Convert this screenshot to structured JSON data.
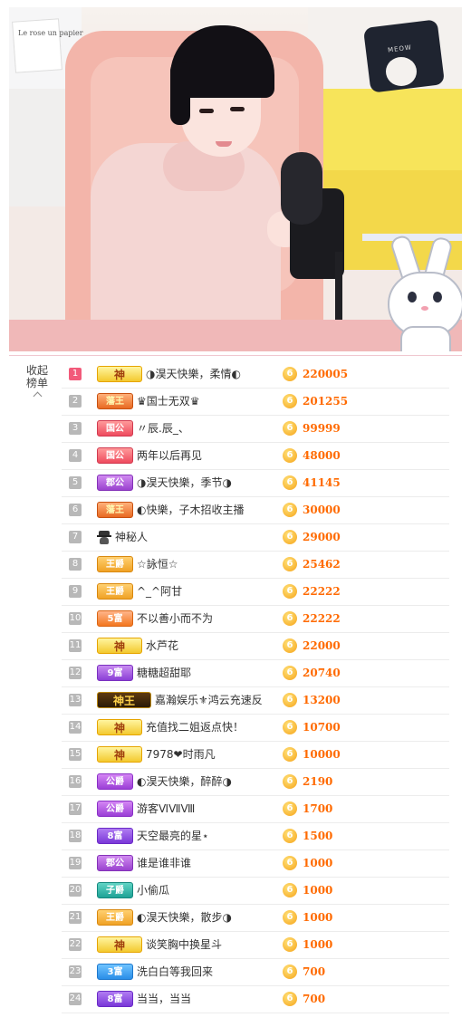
{
  "stream": {
    "poster_text": "Le rose un papier",
    "pillow_text": "MEOW"
  },
  "sidebar": {
    "collapse_label": "收起",
    "title": "榜单"
  },
  "ranking": [
    {
      "rank": "1",
      "badge": "神",
      "badge_type": "shen",
      "name": "◑淏天快樂，柔情◐",
      "amount": "220005"
    },
    {
      "rank": "2",
      "badge": "藩王",
      "badge_type": "wang",
      "name": "♛国士无双♛",
      "amount": "201255"
    },
    {
      "rank": "3",
      "badge": "国公",
      "badge_type": "guo",
      "name": "〃辰.辰_、",
      "amount": "99999"
    },
    {
      "rank": "4",
      "badge": "国公",
      "badge_type": "guo",
      "name": "两年以后再见",
      "amount": "48000"
    },
    {
      "rank": "5",
      "badge": "郡公",
      "badge_type": "du",
      "name": "◑淏天快樂，季节◑",
      "amount": "41145"
    },
    {
      "rank": "6",
      "badge": "藩王",
      "badge_type": "wang",
      "name": "◐快樂，子木招收主播",
      "amount": "30000"
    },
    {
      "rank": "7",
      "badge": "",
      "badge_type": "mystery",
      "name": "神秘人",
      "amount": "29000"
    },
    {
      "rank": "8",
      "badge": "王爵",
      "badge_type": "wj",
      "name": "☆詠恒☆",
      "amount": "25462"
    },
    {
      "rank": "9",
      "badge": "王爵",
      "badge_type": "wj",
      "name": "^_^阿甘",
      "amount": "22222"
    },
    {
      "rank": "10",
      "badge": "5富",
      "badge_type": "fu5",
      "name": "不以善小而不为",
      "amount": "22222"
    },
    {
      "rank": "11",
      "badge": "神",
      "badge_type": "shen",
      "name": "水芦花",
      "amount": "22000"
    },
    {
      "rank": "12",
      "badge": "9富",
      "badge_type": "fu9",
      "name": "糖糖超甜耶",
      "amount": "20740"
    },
    {
      "rank": "13",
      "badge": "神王",
      "badge_type": "shenwang",
      "name": "嘉瀚娱乐⚜鸿云充速反",
      "amount": "13200"
    },
    {
      "rank": "14",
      "badge": "神",
      "badge_type": "shen",
      "name": "充值找二姐返点快！",
      "amount": "10700"
    },
    {
      "rank": "15",
      "badge": "神",
      "badge_type": "shen",
      "name": "7978❤时雨凡",
      "amount": "10000"
    },
    {
      "rank": "16",
      "badge": "公爵",
      "badge_type": "gong",
      "name": "◐淏天快樂，醉醉◑",
      "amount": "2190"
    },
    {
      "rank": "17",
      "badge": "公爵",
      "badge_type": "gong",
      "name": "游客ⅥⅦⅧ",
      "amount": "1700"
    },
    {
      "rank": "18",
      "badge": "8富",
      "badge_type": "fu8",
      "name": "天空最亮的星⋆",
      "amount": "1500"
    },
    {
      "rank": "19",
      "badge": "郡公",
      "badge_type": "du",
      "name": "谁是谁非谁",
      "amount": "1000"
    },
    {
      "rank": "20",
      "badge": "子爵",
      "badge_type": "zi",
      "name": "小偷瓜",
      "amount": "1000"
    },
    {
      "rank": "21",
      "badge": "王爵",
      "badge_type": "wj",
      "name": "◐淏天快樂，散步◑",
      "amount": "1000"
    },
    {
      "rank": "22",
      "badge": "神",
      "badge_type": "shen",
      "name": "谈笑胸中换星斗",
      "amount": "1000"
    },
    {
      "rank": "23",
      "badge": "3富",
      "badge_type": "fu3",
      "name": "洗白白等我回来",
      "amount": "700"
    },
    {
      "rank": "24",
      "badge": "8富",
      "badge_type": "fu8",
      "name": "当当，当当",
      "amount": "700"
    }
  ],
  "coin_symbol": "6",
  "colors": {
    "accent": "#ff6a00",
    "top_rank": "#f25a7a",
    "rank_default": "#b8b8b8"
  }
}
